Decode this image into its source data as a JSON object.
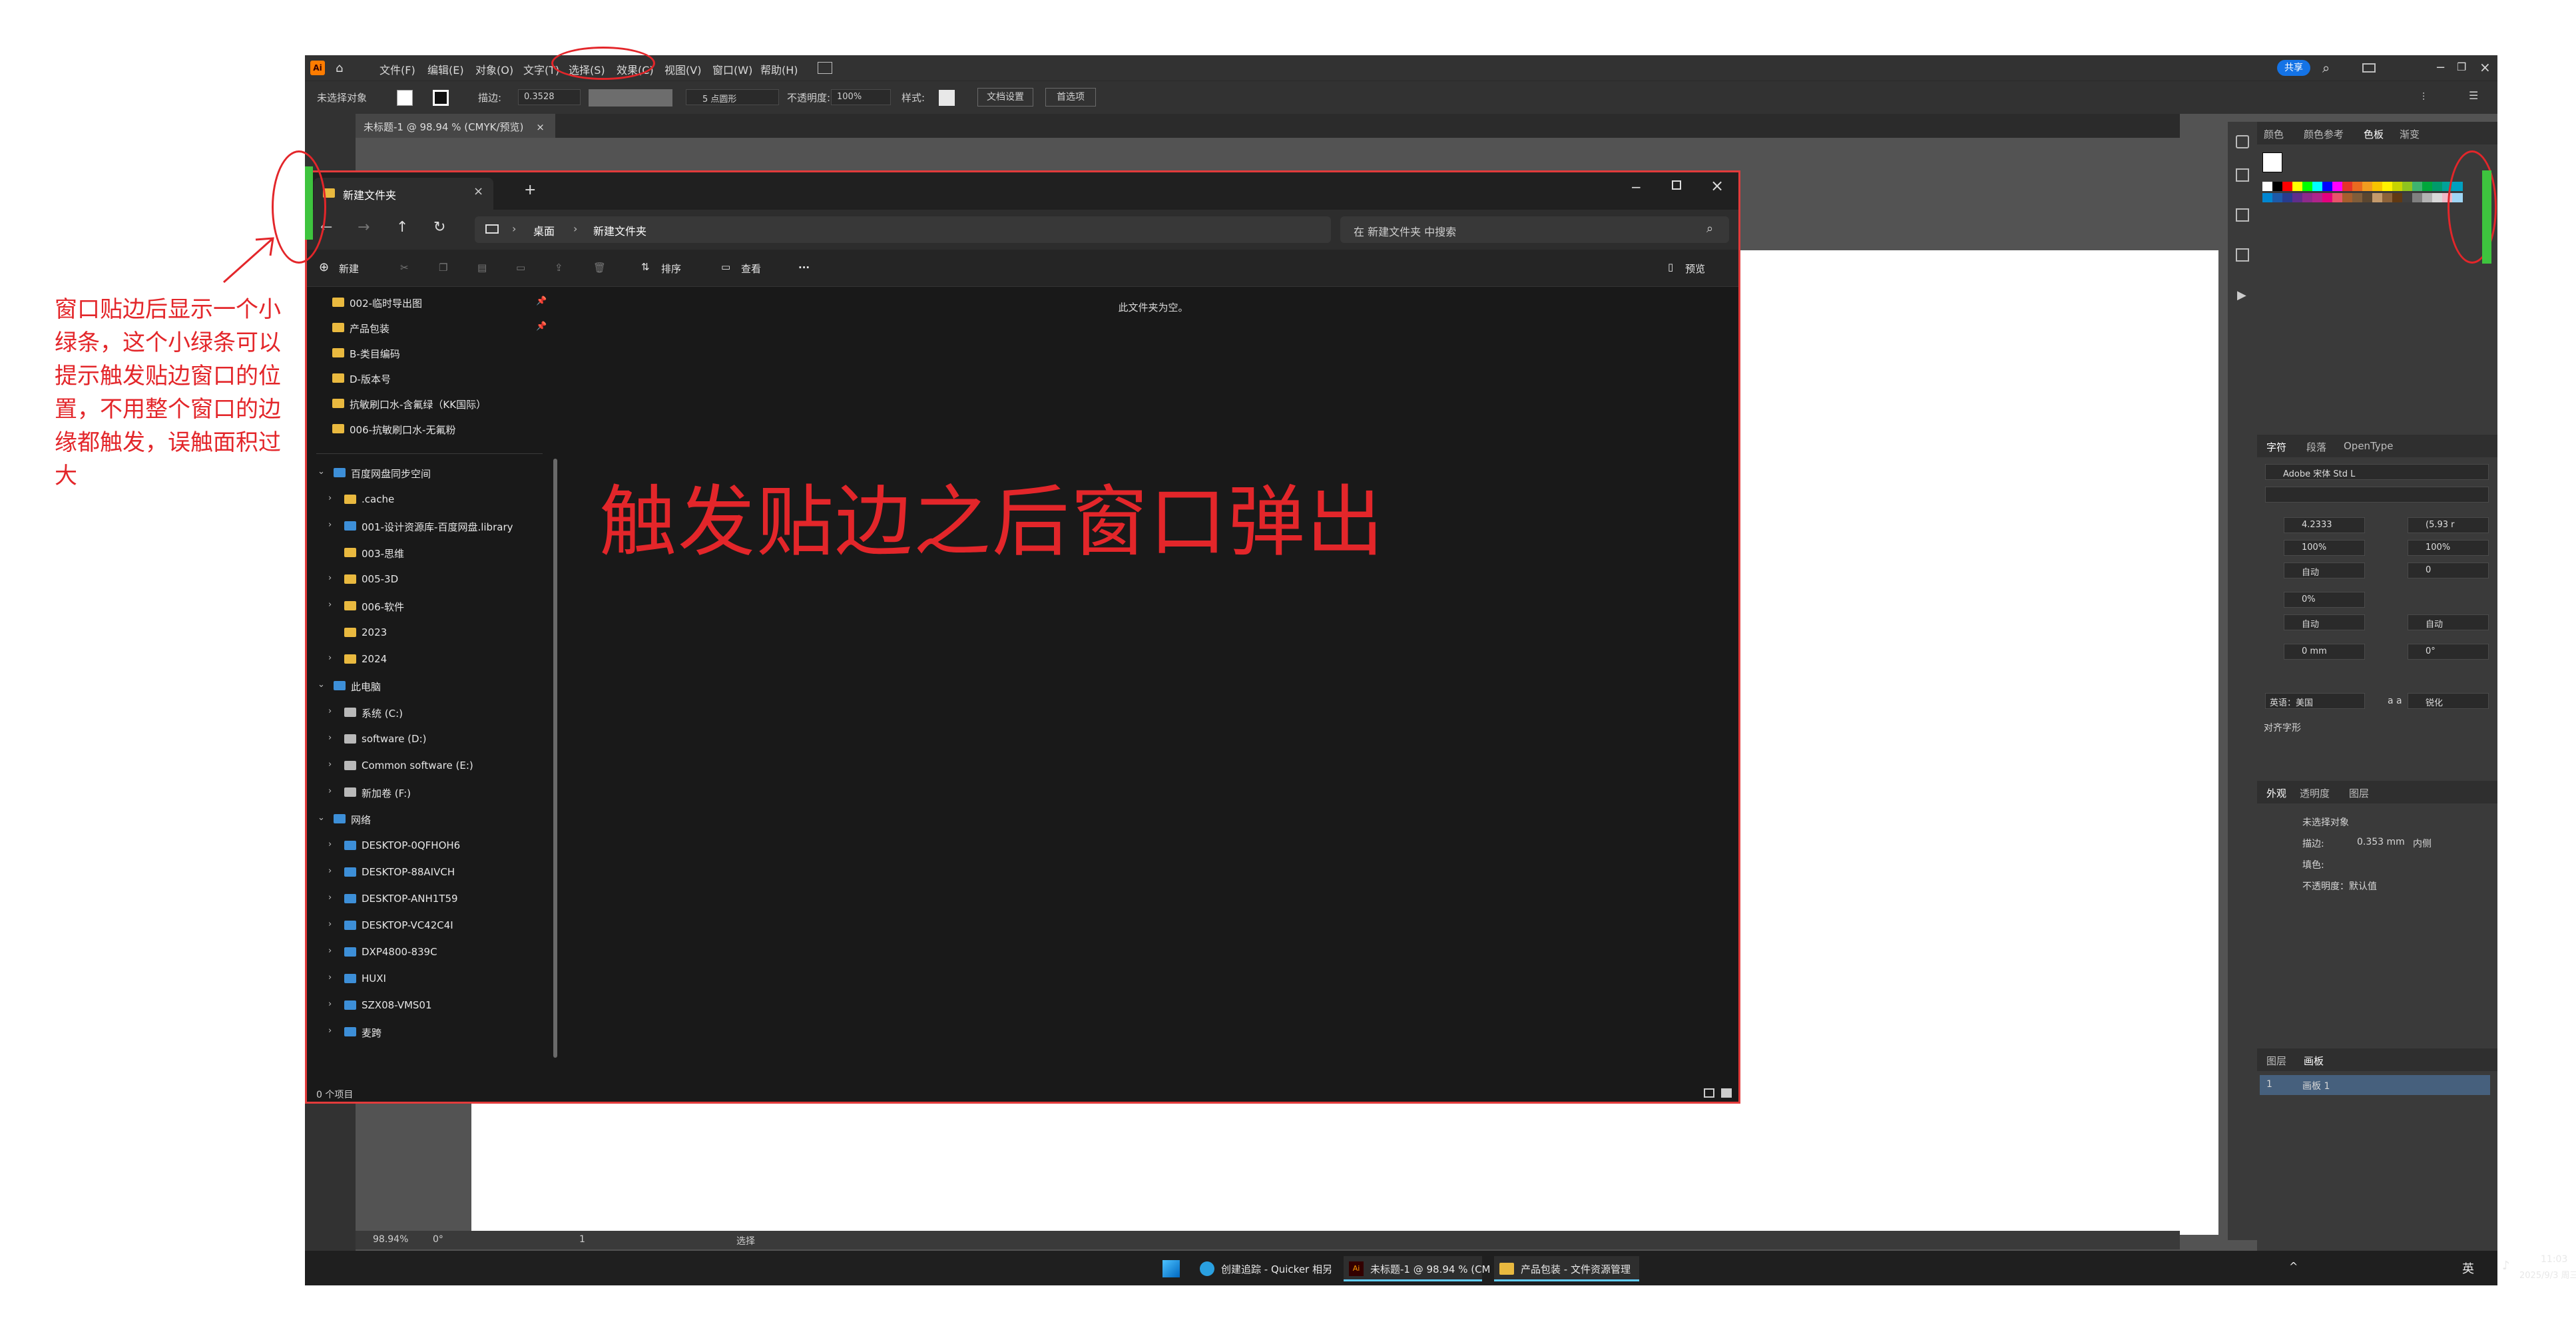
{
  "menubar": {
    "logo": "Ai",
    "items": [
      "文件(F)",
      "编辑(E)",
      "对象(O)",
      "文字(T)",
      "选择(S)",
      "效果(C)",
      "视图(V)",
      "窗口(W)",
      "帮助(H)"
    ],
    "share_label": "共享"
  },
  "control_bar": {
    "selection_status": "未选择对象",
    "stroke_label": "描边:",
    "stroke_value": "0.3528",
    "brush_value": "5 点圆形",
    "opacity_label": "不透明度:",
    "opacity_value": "100%",
    "style_label": "样式:",
    "doc_setup_button": "文档设置",
    "preferences_button": "首选项"
  },
  "document_tab": {
    "label": "未标题-1 @ 98.94 % (CMYK/预览)",
    "close": "×"
  },
  "status_bar": {
    "zoom": "98.94%",
    "rotation": "0°",
    "artboard_number": "1",
    "tool_name": "选择"
  },
  "right_panel": {
    "top_tabs": [
      "颜色",
      "颜色参考",
      "色板",
      "渐变"
    ],
    "active_top_tab": "色板",
    "char_tabs": [
      "字符",
      "段落",
      "OpenType"
    ],
    "font_name": "Adobe 宋体 Std L",
    "font_size": "4.2333",
    "leading": "(5.93 r",
    "vscale": "100%",
    "hscale": "100%",
    "kerning": "自动",
    "tracking": "0",
    "baseline_shift": "0%",
    "auto1": "自动",
    "auto2": "自动",
    "indent": "0 mm",
    "rotate": "0°",
    "language": "英语：美国",
    "aa_label": "a a",
    "aa_value": "锐化",
    "glyph_label": "对齐字形",
    "appearance_tabs": [
      "外观",
      "透明度",
      "图层"
    ],
    "appearance_title": "未选择对象",
    "stroke_row_label": "描边:",
    "stroke_row_value": "0.353 mm",
    "stroke_row_align": "内侧",
    "fill_row_label": "填色:",
    "opacity_row": "不透明度：默认值",
    "artboards_tabs": [
      "图层",
      "画板"
    ],
    "artboard_row_num": "1",
    "artboard_row_name": "画板 1"
  },
  "explorer": {
    "tab_title": "新建文件夹",
    "address": [
      "桌面",
      "新建文件夹"
    ],
    "search_placeholder": "在 新建文件夹 中搜索",
    "cmd": {
      "new": "新建",
      "sort": "排序",
      "view": "查看",
      "more": "···",
      "details": "预览"
    },
    "quick_access": [
      {
        "label": "002-临时导出图",
        "pinned": true
      },
      {
        "label": "产品包装",
        "pinned": true
      },
      {
        "label": "B-类目编码",
        "pinned": false
      },
      {
        "label": "D-版本号",
        "pinned": false
      },
      {
        "label": "抗敏刷口水-含氟绿（KK国际）",
        "pinned": false
      },
      {
        "label": "006-抗敏刷口水-无氟粉",
        "pinned": false
      }
    ],
    "tree": [
      {
        "label": "百度网盘同步空间",
        "icon": "pc",
        "level": 0,
        "twisty": "v"
      },
      {
        "label": ".cache",
        "icon": "folder",
        "level": 1,
        "twisty": ">"
      },
      {
        "label": "001-设计资源库-百度网盘.library",
        "icon": "pc",
        "level": 1,
        "twisty": ">"
      },
      {
        "label": "003-思维",
        "icon": "folder",
        "level": 1,
        "twisty": ""
      },
      {
        "label": "005-3D",
        "icon": "folder",
        "level": 1,
        "twisty": ">"
      },
      {
        "label": "006-软件",
        "icon": "folder",
        "level": 1,
        "twisty": ">"
      },
      {
        "label": "2023",
        "icon": "folder",
        "level": 1,
        "twisty": ""
      },
      {
        "label": "2024",
        "icon": "folder",
        "level": 1,
        "twisty": ">"
      },
      {
        "label": "此电脑",
        "icon": "pc",
        "level": 0,
        "twisty": "v"
      },
      {
        "label": "系统 (C:)",
        "icon": "drive",
        "level": 1,
        "twisty": ">"
      },
      {
        "label": "software (D:)",
        "icon": "drive",
        "level": 1,
        "twisty": ">"
      },
      {
        "label": "Common software (E:)",
        "icon": "drive",
        "level": 1,
        "twisty": ">"
      },
      {
        "label": "新加卷 (F:)",
        "icon": "drive",
        "level": 1,
        "twisty": ">"
      },
      {
        "label": "网络",
        "icon": "pc",
        "level": 0,
        "twisty": "v"
      },
      {
        "label": "DESKTOP-0QFHOH6",
        "icon": "pc",
        "level": 1,
        "twisty": ">"
      },
      {
        "label": "DESKTOP-88AIVCH",
        "icon": "pc",
        "level": 1,
        "twisty": ">"
      },
      {
        "label": "DESKTOP-ANH1T59",
        "icon": "pc",
        "level": 1,
        "twisty": ">"
      },
      {
        "label": "DESKTOP-VC42C4I",
        "icon": "pc",
        "level": 1,
        "twisty": ">"
      },
      {
        "label": "DXP4800-839C",
        "icon": "pc",
        "level": 1,
        "twisty": ">"
      },
      {
        "label": "HUXI",
        "icon": "pc",
        "level": 1,
        "twisty": ">"
      },
      {
        "label": "SZX08-VMS01",
        "icon": "pc",
        "level": 1,
        "twisty": ">"
      },
      {
        "label": "麦跨",
        "icon": "pc",
        "level": 1,
        "twisty": ">"
      }
    ],
    "empty_text": "此文件夹为空。",
    "status": "0 个项目"
  },
  "taskbar": {
    "apps": [
      "创建追踪 - Quicker 相另",
      "未标题-1 @ 98.94 % (CM",
      "产品包装 - 文件资源管理"
    ],
    "ime": "英",
    "time": "11:03",
    "date": "2025/9/3 周三"
  },
  "annotations": {
    "main": "触发贴边之后窗口弹出",
    "side": "窗口贴边后显示一个小绿条，这个小绿条可以提示触发贴边窗口的位置，不用整个窗口的边缘都触发，误触面积过大"
  },
  "colors": {
    "annotation": "#e3262a",
    "green_bar": "#3ec43e",
    "window_border": "#e23b3b"
  }
}
